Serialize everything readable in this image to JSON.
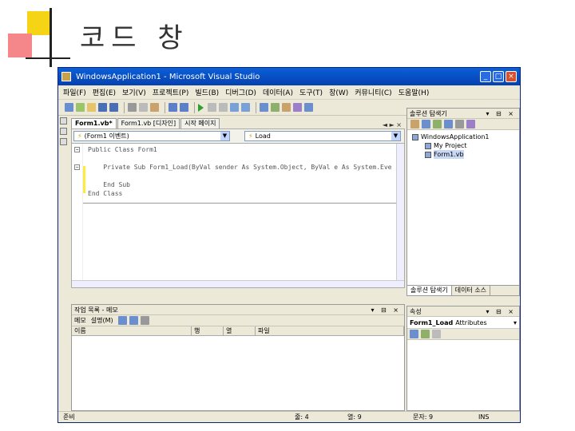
{
  "slide": {
    "title": "코드 창"
  },
  "window": {
    "title": "WindowsApplication1 - Microsoft Visual Studio",
    "controls": {
      "minimize": "_",
      "maximize": "□",
      "close": "×"
    }
  },
  "menu": [
    "파일(F)",
    "편집(E)",
    "보기(V)",
    "프로젝트(P)",
    "빌드(B)",
    "디버그(D)",
    "데이터(A)",
    "도구(T)",
    "창(W)",
    "커뮤니티(C)",
    "도움말(H)"
  ],
  "editor": {
    "tabs": [
      "Form1.vb*",
      "Form1.vb [디자인]",
      "시작 페이지"
    ],
    "tab_controls": "◄ ► ×",
    "object_combo": "(Form1 이벤트)",
    "method_combo": "Load",
    "lines": [
      "Public Class Form1",
      "    Private Sub Form1_Load(ByVal sender As System.Object, ByVal e As System.Eve",
      "    End Sub",
      "End Class"
    ]
  },
  "solution_explorer": {
    "title": "솔루션 탐색기",
    "panel_controls": "▾ ⊟ ×",
    "tree": [
      "WindowsApplication1",
      "My Project",
      "Form1.vb"
    ],
    "tabs": [
      "솔루션 탐색기",
      "데이터 소스"
    ]
  },
  "properties": {
    "title": "속성",
    "panel_controls": "▾ ⊟ ×",
    "object_name": "Form1_Load",
    "object_type": "Attributes"
  },
  "task_list": {
    "title": "작업 목록 - 메모",
    "panel_controls": "▾ ⊟ ×",
    "toolbar": [
      "메모",
      "설명(M)"
    ],
    "columns": [
      "이름",
      "행",
      "열",
      "파일"
    ]
  },
  "status": {
    "ready": "준비",
    "line": "줄: 4",
    "col": "열: 9",
    "char": "문자: 9",
    "mode": "INS"
  },
  "colors": {
    "title_bar": "#0641b0",
    "chrome": "#ece9d8",
    "deco_yellow": "#f5d315",
    "deco_red": "#f5878a"
  }
}
